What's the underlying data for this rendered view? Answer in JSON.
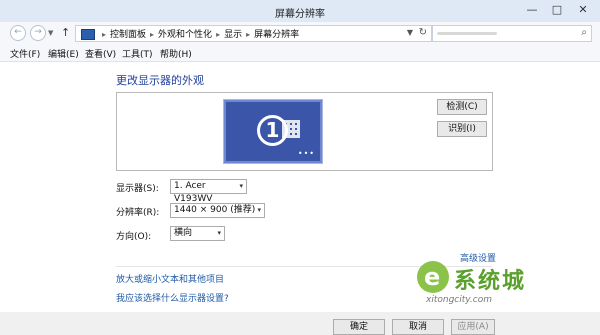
{
  "window": {
    "title": "屏幕分辨率",
    "minimize": "—",
    "maximize": "□",
    "close": "✕"
  },
  "address": {
    "back": "←",
    "forward": "→",
    "history": "▼",
    "up": "↑",
    "crumbs": [
      "控制面板",
      "外观和个性化",
      "显示",
      "屏幕分辨率"
    ],
    "crumb_sep": "▸",
    "dropdown": "▼",
    "refresh": "↻",
    "search_placeholder": "",
    "search_icon": "⌕"
  },
  "menu": [
    "文件(F)",
    "编辑(E)",
    "查看(V)",
    "工具(T)",
    "帮助(H)"
  ],
  "content": {
    "heading": "更改显示器的外观",
    "monitor_number": "1",
    "monitor_dots": "•••",
    "detect": "检测(C)",
    "identify": "识别(I)",
    "display_label": "显示器(S):",
    "display_value": "1. Acer V193WV",
    "resolution_label": "分辨率(R):",
    "resolution_value": "1440 × 900 (推荐)",
    "orientation_label": "方向(O):",
    "orientation_value": "横向",
    "advanced": "高级设置",
    "link1": "放大或缩小文本和其他项目",
    "link2": "我应该选择什么显示器设置?",
    "select_arrow": "▾"
  },
  "buttons": {
    "ok": "确定",
    "cancel": "取消",
    "apply": "应用(A)"
  },
  "watermark": {
    "logo": "e",
    "cn": "系统城",
    "en": "xitongcity.com"
  },
  "colors": {
    "accent": "#1f3f9d",
    "monitor": "#3b55a8",
    "link": "#1f5aa6"
  }
}
